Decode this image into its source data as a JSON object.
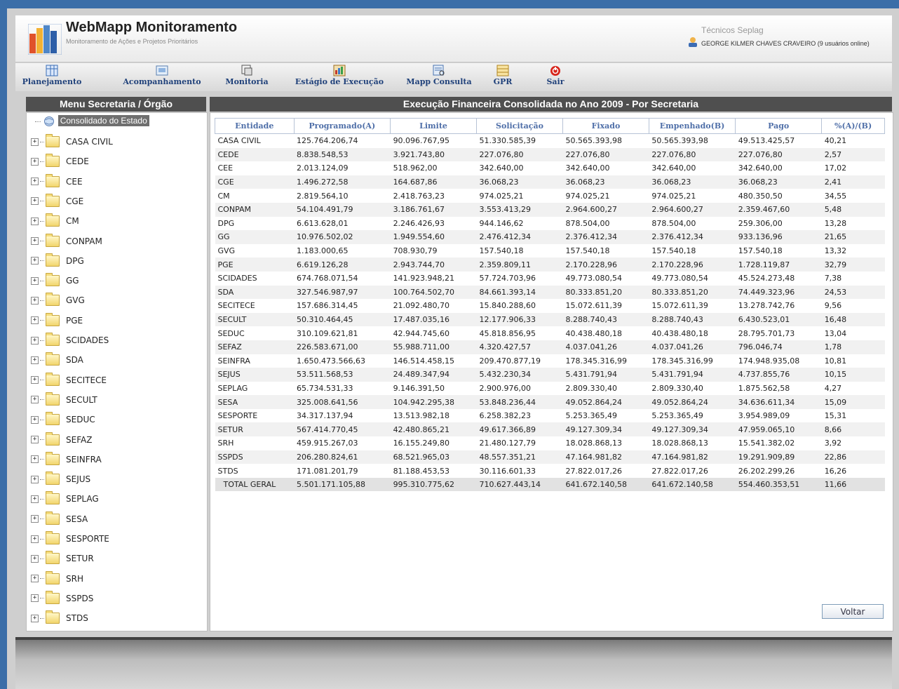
{
  "header": {
    "title": "WebMapp Monitoramento",
    "subtitle": "Monitoramento de Ações e Projetos Prioritários",
    "team": "Técnicos Seplag",
    "user": "GEORGE KILMER CHAVES CRAVEIRO (9 usuários online)"
  },
  "toolbar": {
    "items": [
      {
        "label": "Planejamento",
        "icon": "planning-icon"
      },
      {
        "label": "Acompanhamento",
        "icon": "tracking-icon"
      },
      {
        "label": "Monitoria",
        "icon": "monitor-icon"
      },
      {
        "label": "Estágio de Execução",
        "icon": "execution-stage-icon"
      },
      {
        "label": "Mapp Consulta",
        "icon": "query-icon"
      },
      {
        "label": "GPR",
        "icon": "gpr-icon"
      },
      {
        "label": "Sair",
        "icon": "exit-icon"
      }
    ]
  },
  "sidebar": {
    "title": "Menu Secretaria / Órgão",
    "root": "Consolidado do Estado",
    "items": [
      "CASA CIVIL",
      "CEDE",
      "CEE",
      "CGE",
      "CM",
      "CONPAM",
      "DPG",
      "GG",
      "GVG",
      "PGE",
      "SCIDADES",
      "SDA",
      "SECITECE",
      "SECULT",
      "SEDUC",
      "SEFAZ",
      "SEINFRA",
      "SEJUS",
      "SEPLAG",
      "SESA",
      "SESPORTE",
      "SETUR",
      "SRH",
      "SSPDS",
      "STDS"
    ]
  },
  "main": {
    "title": "Execução Financeira Consolidada no Ano 2009 - Por Secretaria",
    "columns": [
      "Entidade",
      "Programado(A)",
      "Limite",
      "Solicitação",
      "Fixado",
      "Empenhado(B)",
      "Pago",
      "%(A)/(B)"
    ],
    "rows": [
      [
        "CASA CIVIL",
        "125.764.206,74",
        "90.096.767,95",
        "51.330.585,39",
        "50.565.393,98",
        "50.565.393,98",
        "49.513.425,57",
        "40,21"
      ],
      [
        "CEDE",
        "8.838.548,53",
        "3.921.743,80",
        "227.076,80",
        "227.076,80",
        "227.076,80",
        "227.076,80",
        "2,57"
      ],
      [
        "CEE",
        "2.013.124,09",
        "518.962,00",
        "342.640,00",
        "342.640,00",
        "342.640,00",
        "342.640,00",
        "17,02"
      ],
      [
        "CGE",
        "1.496.272,58",
        "164.687,86",
        "36.068,23",
        "36.068,23",
        "36.068,23",
        "36.068,23",
        "2,41"
      ],
      [
        "CM",
        "2.819.564,10",
        "2.418.763,23",
        "974.025,21",
        "974.025,21",
        "974.025,21",
        "480.350,50",
        "34,55"
      ],
      [
        "CONPAM",
        "54.104.491,79",
        "3.186.761,67",
        "3.553.413,29",
        "2.964.600,27",
        "2.964.600,27",
        "2.359.467,60",
        "5,48"
      ],
      [
        "DPG",
        "6.613.628,01",
        "2.246.426,93",
        "944.146,62",
        "878.504,00",
        "878.504,00",
        "259.306,00",
        "13,28"
      ],
      [
        "GG",
        "10.976.502,02",
        "1.949.554,60",
        "2.476.412,34",
        "2.376.412,34",
        "2.376.412,34",
        "933.136,96",
        "21,65"
      ],
      [
        "GVG",
        "1.183.000,65",
        "708.930,79",
        "157.540,18",
        "157.540,18",
        "157.540,18",
        "157.540,18",
        "13,32"
      ],
      [
        "PGE",
        "6.619.126,28",
        "2.943.744,70",
        "2.359.809,11",
        "2.170.228,96",
        "2.170.228,96",
        "1.728.119,87",
        "32,79"
      ],
      [
        "SCIDADES",
        "674.768.071,54",
        "141.923.948,21",
        "57.724.703,96",
        "49.773.080,54",
        "49.773.080,54",
        "45.524.273,48",
        "7,38"
      ],
      [
        "SDA",
        "327.546.987,97",
        "100.764.502,70",
        "84.661.393,14",
        "80.333.851,20",
        "80.333.851,20",
        "74.449.323,96",
        "24,53"
      ],
      [
        "SECITECE",
        "157.686.314,45",
        "21.092.480,70",
        "15.840.288,60",
        "15.072.611,39",
        "15.072.611,39",
        "13.278.742,76",
        "9,56"
      ],
      [
        "SECULT",
        "50.310.464,45",
        "17.487.035,16",
        "12.177.906,33",
        "8.288.740,43",
        "8.288.740,43",
        "6.430.523,01",
        "16,48"
      ],
      [
        "SEDUC",
        "310.109.621,81",
        "42.944.745,60",
        "45.818.856,95",
        "40.438.480,18",
        "40.438.480,18",
        "28.795.701,73",
        "13,04"
      ],
      [
        "SEFAZ",
        "226.583.671,00",
        "55.988.711,00",
        "4.320.427,57",
        "4.037.041,26",
        "4.037.041,26",
        "796.046,74",
        "1,78"
      ],
      [
        "SEINFRA",
        "1.650.473.566,63",
        "146.514.458,15",
        "209.470.877,19",
        "178.345.316,99",
        "178.345.316,99",
        "174.948.935,08",
        "10,81"
      ],
      [
        "SEJUS",
        "53.511.568,53",
        "24.489.347,94",
        "5.432.230,34",
        "5.431.791,94",
        "5.431.791,94",
        "4.737.855,76",
        "10,15"
      ],
      [
        "SEPLAG",
        "65.734.531,33",
        "9.146.391,50",
        "2.900.976,00",
        "2.809.330,40",
        "2.809.330,40",
        "1.875.562,58",
        "4,27"
      ],
      [
        "SESA",
        "325.008.641,56",
        "104.942.295,38",
        "53.848.236,44",
        "49.052.864,24",
        "49.052.864,24",
        "34.636.611,34",
        "15,09"
      ],
      [
        "SESPORTE",
        "34.317.137,94",
        "13.513.982,18",
        "6.258.382,23",
        "5.253.365,49",
        "5.253.365,49",
        "3.954.989,09",
        "15,31"
      ],
      [
        "SETUR",
        "567.414.770,45",
        "42.480.865,21",
        "49.617.366,89",
        "49.127.309,34",
        "49.127.309,34",
        "47.959.065,10",
        "8,66"
      ],
      [
        "SRH",
        "459.915.267,03",
        "16.155.249,80",
        "21.480.127,79",
        "18.028.868,13",
        "18.028.868,13",
        "15.541.382,02",
        "3,92"
      ],
      [
        "SSPDS",
        "206.280.824,61",
        "68.521.965,03",
        "48.557.351,21",
        "47.164.981,82",
        "47.164.981,82",
        "19.291.909,89",
        "22,86"
      ],
      [
        "STDS",
        "171.081.201,79",
        "81.188.453,53",
        "30.116.601,33",
        "27.822.017,26",
        "27.822.017,26",
        "26.202.299,26",
        "16,26"
      ]
    ],
    "total": [
      "TOTAL GERAL",
      "5.501.171.105,88",
      "995.310.775,62",
      "710.627.443,14",
      "641.672.140,58",
      "641.672.140,58",
      "554.460.353,51",
      "11,66"
    ],
    "back_label": "Voltar"
  }
}
